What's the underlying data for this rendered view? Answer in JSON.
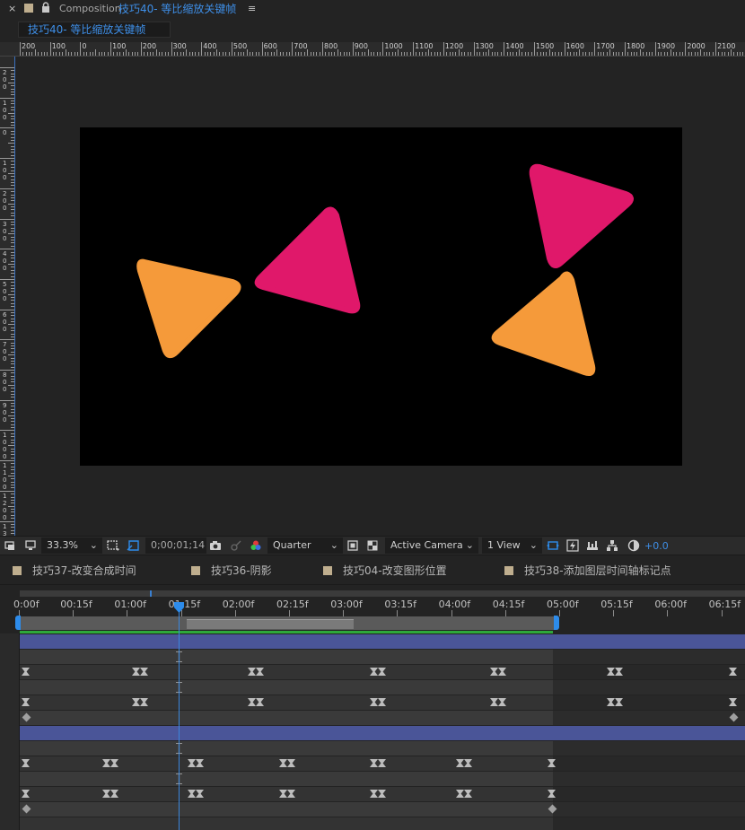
{
  "panel": {
    "close_glyph": "×",
    "lock_glyph": "🔒",
    "prefix": "Composition",
    "comp_name": "技巧40- 等比缩放关键帧",
    "menu_glyph": "≡",
    "tab_label": "技巧40- 等比缩放关键帧"
  },
  "rulers": {
    "h_labels": [
      "200",
      "100",
      "0",
      "100",
      "200",
      "300",
      "400",
      "500",
      "600",
      "700",
      "800",
      "900",
      "1000",
      "1100",
      "1200",
      "1300",
      "1400",
      "1500",
      "1600",
      "1700",
      "1800",
      "1900",
      "2000",
      "2100"
    ],
    "v_labels": [
      "200",
      "100",
      "0",
      "100",
      "200",
      "300",
      "400",
      "500",
      "600",
      "700",
      "800",
      "900",
      "1000",
      "1100",
      "1200",
      "1300"
    ]
  },
  "viewer_toolbar": {
    "zoom": "33.3%",
    "timecode": "0;00;01;14",
    "resolution": "Quarter",
    "camera": "Active Camera",
    "views": "1 View",
    "exposure": "+0.0",
    "chevron": "⌄"
  },
  "timeline_tabs": [
    {
      "label": "技巧37-改变合成时间"
    },
    {
      "label": "技巧36-阴影"
    },
    {
      "label": "技巧04-改变图形位置"
    },
    {
      "label": "技巧38-添加图层时间轴标记点"
    }
  ],
  "time_ruler": {
    "labels": [
      "0:00f",
      "00:15f",
      "01:00f",
      "01:15f",
      "02:00f",
      "02:15f",
      "03:00f",
      "03:15f",
      "04:00f",
      "04:15f",
      "05:00f",
      "05:15f",
      "06:00f",
      "06:15f"
    ]
  },
  "colors": {
    "accent": "#2d8ceb",
    "title_blue": "#3e8ee6",
    "triangle_orange": "#f59a3a",
    "triangle_pink": "#e0186a",
    "layer_bar": "#4a5598",
    "work_green": "#2ea83a"
  }
}
